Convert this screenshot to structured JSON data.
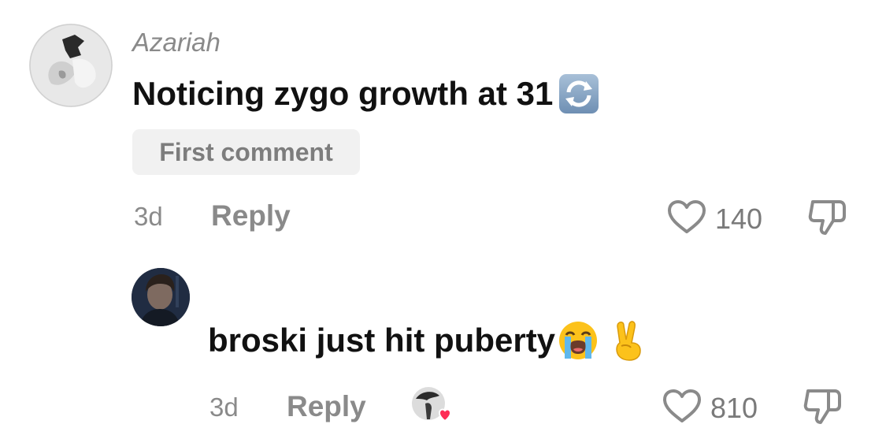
{
  "comments": [
    {
      "username": "Azariah",
      "text": "Noticing zygo growth at 31",
      "text_emoji_icons": [
        "arrows-counterclockwise-icon"
      ],
      "badge": "First comment",
      "time": "3d",
      "reply_label": "Reply",
      "likes": "140"
    }
  ],
  "replies": [
    {
      "text": "broski just hit puberty",
      "text_emoji_icons": [
        "loudly-crying-face-icon",
        "victory-hand-icon"
      ],
      "time": "3d",
      "reply_label": "Reply",
      "likes": "810",
      "creator_liked": true
    }
  ],
  "colors": {
    "secondary_text": "#8a8a8a",
    "primary_text": "#111111",
    "badge_bg": "#f1f1f1",
    "heart_red": "#fe2c55"
  }
}
